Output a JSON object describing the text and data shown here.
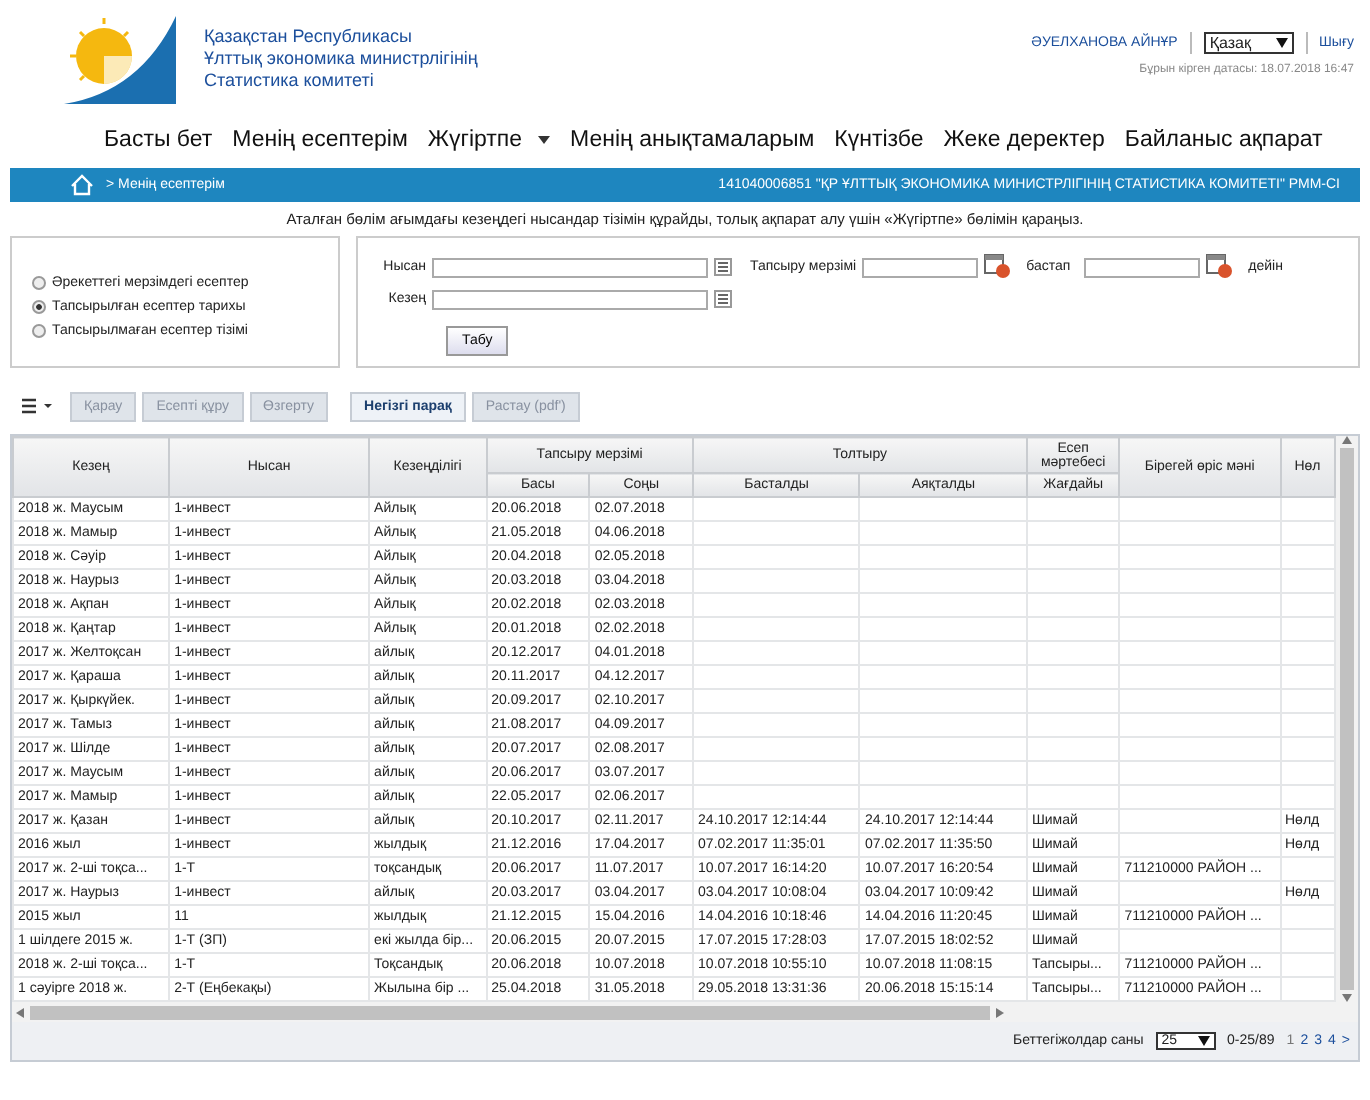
{
  "header": {
    "org_lines": [
      "Қазақстан Республикасы",
      "Ұлттық экономика министрлігінің",
      "Статистика комитеті"
    ],
    "user": "ӘУЕЛХАНОВА АЙНҰР",
    "language": "Қазақ",
    "logout": "Шығу",
    "last_login": "Бұрын кірген датасы: 18.07.2018 16:47"
  },
  "menu": [
    {
      "label": "Басты бет",
      "dropdown": false
    },
    {
      "label": "Менің есептерім",
      "dropdown": false
    },
    {
      "label": "Жүгіртпе",
      "dropdown": true
    },
    {
      "label": "Менің анықтамаларым",
      "dropdown": false
    },
    {
      "label": "Күнтізбе",
      "dropdown": false
    },
    {
      "label": "Жеке деректер",
      "dropdown": false
    },
    {
      "label": "Байланыс ақпарат",
      "dropdown": false
    }
  ],
  "breadcrumb": {
    "path": "> Менің есептерім",
    "organization": "141040006851 \"ҚР ҰЛТТЫҚ ЭКОНОМИКА МИНИСТРЛІГІНІҢ СТАТИСТИКА КОМИТЕТІ\" РММ-СІ"
  },
  "notice": "Аталған бөлім ағымдағы кезеңдегі нысандар тізімін құрайды, толық ақпарат алу үшін «Жүгіртпе» бөлімін қараңыз.",
  "report_types": [
    {
      "label": "Әрекеттегі мерзімдегі есептер",
      "selected": false
    },
    {
      "label": "Тапсырылған есептер тарихы",
      "selected": true
    },
    {
      "label": "Тапсырылмаған есептер тізімі",
      "selected": false
    }
  ],
  "filters": {
    "form_label": "Нысан",
    "period_label": "Кезең",
    "due_label": "Тапсыру мерзімі",
    "from_label": "бастап",
    "to_label": "дейін",
    "search_button": "Табу"
  },
  "toolbar": [
    {
      "label": "Қарау",
      "disabled": true,
      "selected": false
    },
    {
      "label": "Есепті құру",
      "disabled": true,
      "selected": false
    },
    {
      "label": "Өзгерту",
      "disabled": true,
      "selected": false
    },
    {
      "label": "Негізгі парақ",
      "disabled": false,
      "selected": true
    },
    {
      "label": "Растау (pdf')",
      "disabled": true,
      "selected": false
    }
  ],
  "table": {
    "column_groups": [
      {
        "label": "Кезең"
      },
      {
        "label": "Нысан"
      },
      {
        "label": "Кезеңділігі"
      },
      {
        "label": "Тапсыру мерзімі",
        "subcolumns": [
          "Басы",
          "Соңы"
        ]
      },
      {
        "label": "Толтыру",
        "subcolumns": [
          "Басталды",
          "Аяқталды"
        ]
      },
      {
        "label": "Есеп мәртебесі",
        "subcolumns": [
          "Жағдайы"
        ]
      },
      {
        "label": "Бірегей өріс мәні"
      },
      {
        "label": "Нөл"
      }
    ],
    "rows": [
      [
        "2018 ж. Маусым",
        "1-инвест",
        "Айлық",
        "20.06.2018",
        "02.07.2018",
        null,
        null,
        null,
        null,
        null
      ],
      [
        "2018 ж. Мамыр",
        "1-инвест",
        "Айлық",
        "21.05.2018",
        "04.06.2018",
        null,
        null,
        null,
        null,
        null
      ],
      [
        "2018 ж. Сәуір",
        "1-инвест",
        "Айлық",
        "20.04.2018",
        "02.05.2018",
        null,
        null,
        null,
        null,
        null
      ],
      [
        "2018 ж. Наурыз",
        "1-инвест",
        "Айлық",
        "20.03.2018",
        "03.04.2018",
        null,
        null,
        null,
        null,
        null
      ],
      [
        "2018 ж. Ақпан",
        "1-инвест",
        "Айлық",
        "20.02.2018",
        "02.03.2018",
        null,
        null,
        null,
        null,
        null
      ],
      [
        "2018 ж. Қаңтар",
        "1-инвест",
        "Айлық",
        "20.01.2018",
        "02.02.2018",
        null,
        null,
        null,
        null,
        null
      ],
      [
        "2017 ж. Желтоқсан",
        "1-инвест",
        "айлық",
        "20.12.2017",
        "04.01.2018",
        null,
        null,
        null,
        null,
        null
      ],
      [
        "2017 ж. Қараша",
        "1-инвест",
        "айлық",
        "20.11.2017",
        "04.12.2017",
        null,
        null,
        null,
        null,
        null
      ],
      [
        "2017 ж. Қыркүйек.",
        "1-инвест",
        "айлық",
        "20.09.2017",
        "02.10.2017",
        null,
        null,
        null,
        null,
        null
      ],
      [
        "2017 ж. Тамыз",
        "1-инвест",
        "айлық",
        "21.08.2017",
        "04.09.2017",
        null,
        null,
        null,
        null,
        null
      ],
      [
        "2017 ж. Шілде",
        "1-инвест",
        "айлық",
        "20.07.2017",
        "02.08.2017",
        null,
        null,
        null,
        null,
        null
      ],
      [
        "2017 ж. Маусым",
        "1-инвест",
        "айлық",
        "20.06.2017",
        "03.07.2017",
        null,
        null,
        null,
        null,
        null
      ],
      [
        "2017 ж. Мамыр",
        "1-инвест",
        "айлық",
        "22.05.2017",
        "02.06.2017",
        null,
        null,
        null,
        null,
        null
      ],
      [
        "2017 ж. Қазан",
        "1-инвест",
        "айлық",
        "20.10.2017",
        "02.11.2017",
        "24.10.2017 12:14:44",
        "24.10.2017 12:14:44",
        "Шимай",
        null,
        "Нөлд"
      ],
      [
        "2016 жыл",
        "1-инвест",
        "жылдық",
        "21.12.2016",
        "17.04.2017",
        "07.02.2017 11:35:01",
        "07.02.2017 11:35:50",
        "Шимай",
        null,
        "Нөлд"
      ],
      [
        "2017 ж. 2-ші тоқса...",
        "1-Т",
        "тоқсандық",
        "20.06.2017",
        "11.07.2017",
        "10.07.2017 16:14:20",
        "10.07.2017 16:20:54",
        "Шимай",
        "711210000 РАЙОН ...",
        null
      ],
      [
        "2017 ж. Наурыз",
        "1-инвест",
        "айлық",
        "20.03.2017",
        "03.04.2017",
        "03.04.2017 10:08:04",
        "03.04.2017 10:09:42",
        "Шимай",
        null,
        "Нөлд"
      ],
      [
        "2015 жыл",
        "11",
        "жылдық",
        "21.12.2015",
        "15.04.2016",
        "14.04.2016 10:18:46",
        "14.04.2016 11:20:45",
        "Шимай",
        "711210000 РАЙОН ...",
        null
      ],
      [
        "1 шілдеге 2015 ж.",
        "1-Т (ЗП)",
        "екі жылда бір...",
        "20.06.2015",
        "20.07.2015",
        "17.07.2015 17:28:03",
        "17.07.2015 18:02:52",
        "Шимай",
        null,
        null
      ],
      [
        "2018 ж. 2-ші тоқса...",
        "1-Т",
        "Тоқсандық",
        "20.06.2018",
        "10.07.2018",
        "10.07.2018 10:55:10",
        "10.07.2018 11:08:15",
        "Тапсыры...",
        "711210000 РАЙОН ...",
        null
      ],
      [
        "1 сәуірге 2018 ж.",
        "2-Т (Еңбекақы)",
        "Жылына бір ...",
        "25.04.2018",
        "31.05.2018",
        "29.05.2018 13:31:36",
        "20.06.2018 15:15:14",
        "Тапсыры...",
        "711210000 РАЙОН ...",
        null
      ]
    ]
  },
  "pager": {
    "rows_label": "Беттегіжолдар саны",
    "page_size": "25",
    "range": "0-25/89",
    "pages": [
      {
        "label": "1",
        "selected": true
      },
      {
        "label": "2",
        "selected": false
      },
      {
        "label": "3",
        "selected": false
      },
      {
        "label": "4",
        "selected": false
      }
    ],
    "next": ">"
  }
}
